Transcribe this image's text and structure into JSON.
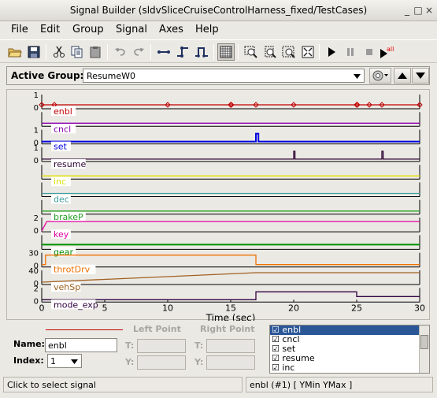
{
  "window": {
    "title": "Signal Builder (sldvSliceCruiseControlHarness_fixed/TestCases)"
  },
  "menu": [
    "File",
    "Edit",
    "Group",
    "Signal",
    "Axes",
    "Help"
  ],
  "toolbar": {
    "buttons": [
      "open-icon",
      "save-icon",
      "cut-icon",
      "copy-icon",
      "paste-icon",
      "undo-icon",
      "redo-icon",
      "line-icon",
      "step-up-icon",
      "step-pulse-icon",
      "grid-icon",
      "zoom-x-icon",
      "zoom-y-icon",
      "zoom-xy-icon",
      "fit-icon",
      "play-icon",
      "pause-icon",
      "stop-icon",
      "run-all-icon"
    ],
    "run_all_badge": "all"
  },
  "group": {
    "label": "Active Group:",
    "value": "ResumeW0"
  },
  "plot": {
    "xlabel": "Time (sec)",
    "xticks": [
      "0",
      "5",
      "10",
      "15",
      "20",
      "25",
      "30"
    ],
    "signals": [
      {
        "name": "enbl",
        "color": "#c00000",
        "ymin": "0",
        "ymax": "1"
      },
      {
        "name": "cncl",
        "color": "#8b00b0",
        "ymin": "",
        "ymax": ""
      },
      {
        "name": "set",
        "color": "#0000e0",
        "ymin": "0",
        "ymax": "1"
      },
      {
        "name": "resume",
        "color": "#2a0030",
        "ymin": "0",
        "ymax": "1"
      },
      {
        "name": "inc",
        "color": "#e0e000",
        "ymin": "",
        "ymax": ""
      },
      {
        "name": "dec",
        "color": "#40a0a0",
        "ymin": "",
        "ymax": ""
      },
      {
        "name": "brakeP",
        "color": "#20a020",
        "ymin": "",
        "ymax": ""
      },
      {
        "name": "key",
        "color": "#e000a0",
        "ymin": "0",
        "ymax": "2"
      },
      {
        "name": "gear",
        "color": "#009000",
        "ymin": "",
        "ymax": ""
      },
      {
        "name": "throtDrv",
        "color": "#f07000",
        "ymin": "0",
        "ymax": "30"
      },
      {
        "name": "vehSp",
        "color": "#a06020",
        "ymin": "0",
        "ymax": "40"
      },
      {
        "name": "mode_exp",
        "color": "#300040",
        "ymin": "0",
        "ymax": "2"
      }
    ]
  },
  "bottom": {
    "left_point": "Left Point",
    "right_point": "Right Point",
    "name_label": "Name:",
    "name_value": "enbl",
    "index_label": "Index:",
    "index_value": "1",
    "t_label": "T:",
    "y_label": "Y:",
    "list": [
      {
        "label": "enbl",
        "checked": "☑"
      },
      {
        "label": "cncl",
        "checked": "☑"
      },
      {
        "label": "set",
        "checked": "☑"
      },
      {
        "label": "resume",
        "checked": "☑"
      },
      {
        "label": "inc",
        "checked": "☑"
      }
    ]
  },
  "status": {
    "left": "Click to select signal",
    "right": "enbl (#1)  [ YMin YMax ]"
  }
}
